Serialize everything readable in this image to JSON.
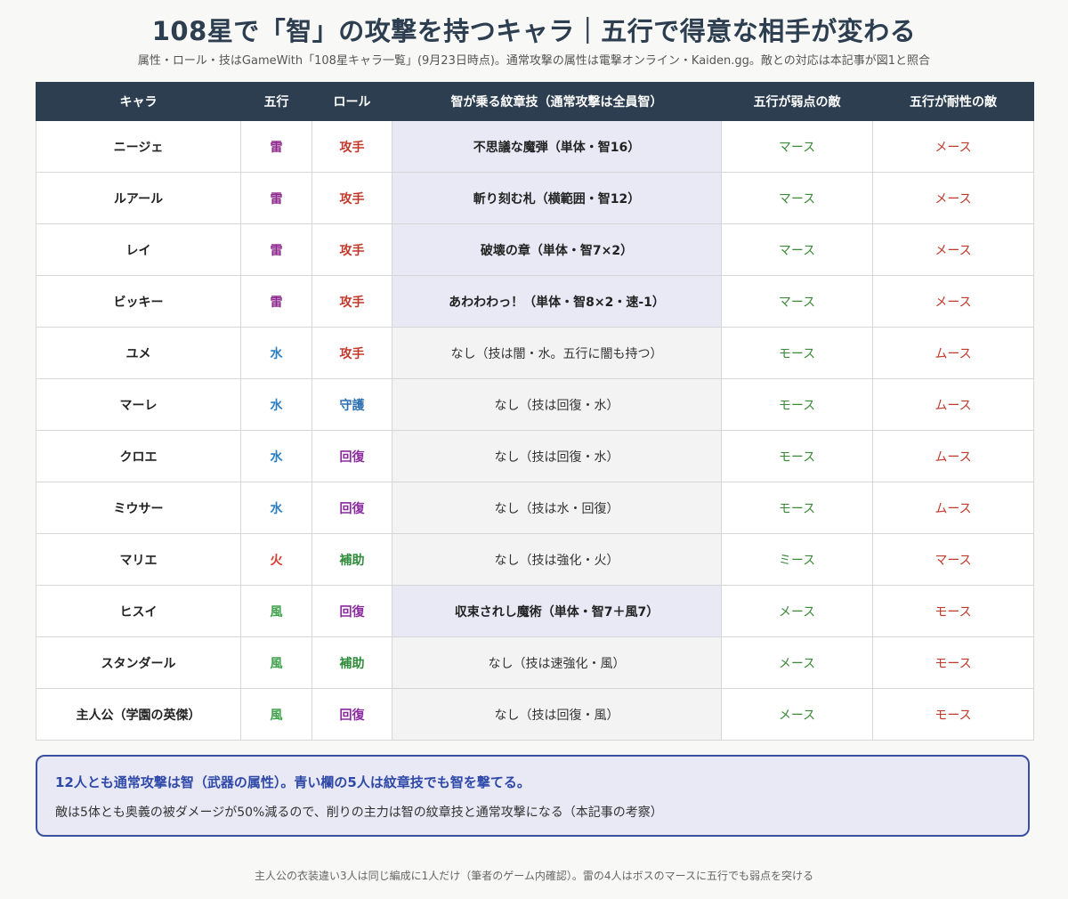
{
  "title": "108星で「智」の攻撃を持つキャラ｜五行で得意な相手が変わる",
  "subtitle": "属性・ロール・技はGameWith「108星キャラ一覧」(9月23日時点)。通常攻撃の属性は電撃オンライン・Kaiden.gg。敵との対応は本記事が図1と照合",
  "colors": {
    "header_bg": "#2c3e50",
    "highlight_bg": "#e8e9f5",
    "weak": "#3a8a3a",
    "resist": "#c0392b",
    "elements": {
      "雷": "#8e2a8e",
      "水": "#2a7fc1",
      "火": "#d63b2f",
      "風": "#3ea14a"
    },
    "roles": {
      "攻手": "#c0392b",
      "守護": "#2a6fb0",
      "回復": "#8a2a9e",
      "補助": "#2e8b3a"
    }
  },
  "table": {
    "headers": [
      "キャラ",
      "五行",
      "ロール",
      "智が乗る紋章技（通常攻撃は全員智）",
      "五行が弱点の敵",
      "五行が耐性の敵"
    ],
    "rows": [
      {
        "name": "ニージェ",
        "element": "雷",
        "role": "攻手",
        "skill": "不思議な魔弾（単体・智16）",
        "highlight": true,
        "weak": "マース",
        "resist": "メース"
      },
      {
        "name": "ルアール",
        "element": "雷",
        "role": "攻手",
        "skill": "斬り刻む札（横範囲・智12）",
        "highlight": true,
        "weak": "マース",
        "resist": "メース"
      },
      {
        "name": "レイ",
        "element": "雷",
        "role": "攻手",
        "skill": "破壊の章（単体・智7×2）",
        "highlight": true,
        "weak": "マース",
        "resist": "メース"
      },
      {
        "name": "ビッキー",
        "element": "雷",
        "role": "攻手",
        "skill": "あわわわっ！（単体・智8×2・速-1）",
        "highlight": true,
        "weak": "マース",
        "resist": "メース"
      },
      {
        "name": "ユメ",
        "element": "水",
        "role": "攻手",
        "skill": "なし（技は闇・水。五行に闇も持つ）",
        "highlight": false,
        "weak": "モース",
        "resist": "ムース"
      },
      {
        "name": "マーレ",
        "element": "水",
        "role": "守護",
        "skill": "なし（技は回復・水）",
        "highlight": false,
        "weak": "モース",
        "resist": "ムース"
      },
      {
        "name": "クロエ",
        "element": "水",
        "role": "回復",
        "skill": "なし（技は回復・水）",
        "highlight": false,
        "weak": "モース",
        "resist": "ムース"
      },
      {
        "name": "ミウサー",
        "element": "水",
        "role": "回復",
        "skill": "なし（技は水・回復）",
        "highlight": false,
        "weak": "モース",
        "resist": "ムース"
      },
      {
        "name": "マリエ",
        "element": "火",
        "role": "補助",
        "skill": "なし（技は強化・火）",
        "highlight": false,
        "weak": "ミース",
        "resist": "マース"
      },
      {
        "name": "ヒスイ",
        "element": "風",
        "role": "回復",
        "skill": "収束されし魔術（単体・智7＋風7）",
        "highlight": true,
        "weak": "メース",
        "resist": "モース"
      },
      {
        "name": "スタンダール",
        "element": "風",
        "role": "補助",
        "skill": "なし（技は速強化・風）",
        "highlight": false,
        "weak": "メース",
        "resist": "モース"
      },
      {
        "name": "主人公（学園の英傑）",
        "element": "風",
        "role": "回復",
        "skill": "なし（技は回復・風）",
        "highlight": false,
        "weak": "メース",
        "resist": "モース"
      }
    ]
  },
  "note": {
    "title": "12人とも通常攻撃は智（武器の属性）。青い欄の5人は紋章技でも智を撃てる。",
    "text": "敵は5体とも奥義の被ダメージが50%減るので、削りの主力は智の紋章技と通常攻撃になる（本記事の考察）"
  },
  "footer": "主人公の衣装違い3人は同じ編成に1人だけ（筆者のゲーム内確認）。雷の4人はボスのマースに五行でも弱点を突ける"
}
